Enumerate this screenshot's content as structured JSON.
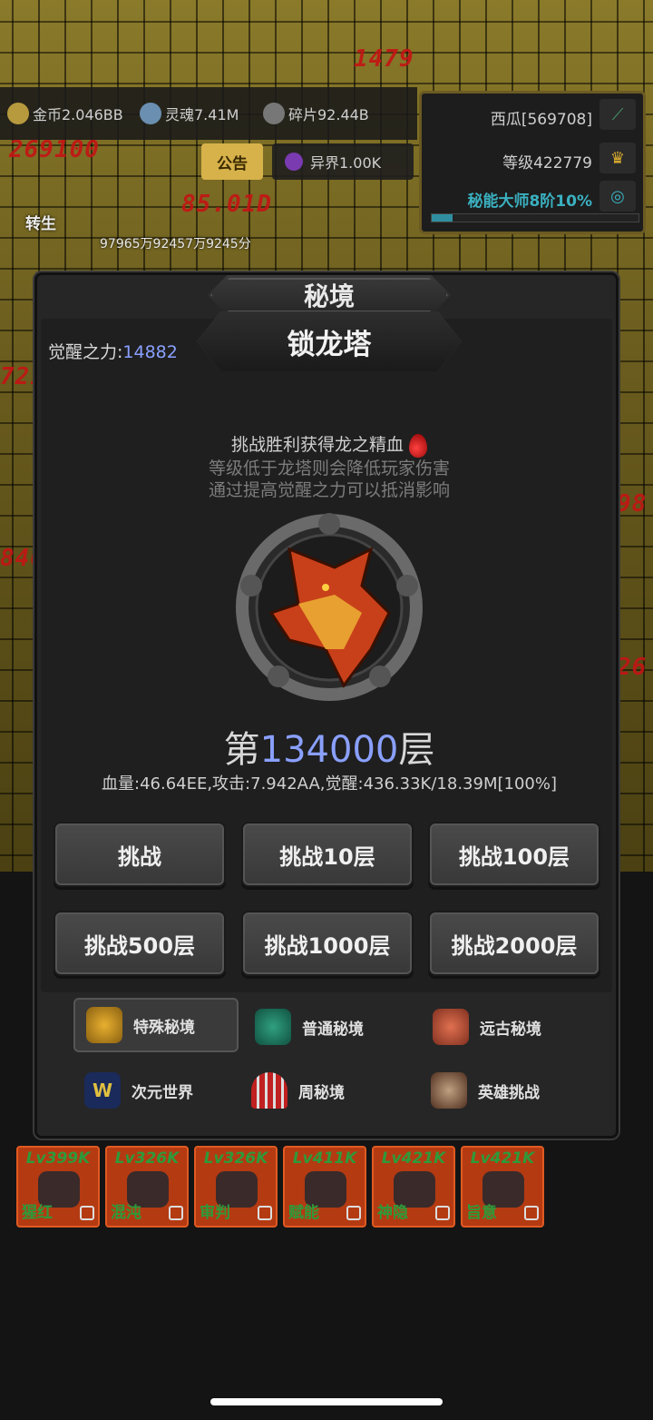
{
  "resources": {
    "gold": "金币2.046BB",
    "soul": "灵魂7.41M",
    "shard": "碎片92.44B",
    "otherworld": "异界1.00K",
    "notice": "公告"
  },
  "player": {
    "name": "西瓜[569708]",
    "level": "等级422779",
    "rank": "秘能大师8阶10%",
    "rank_progress": 0.1,
    "rebirth": "转生",
    "score_line": "97965万92457万9245分"
  },
  "modal": {
    "title": "秘境",
    "tower_name": "锁龙塔",
    "awaken_label": "觉醒之力:",
    "awaken_value": "14882",
    "desc1": "挑战胜利获得龙之精血",
    "desc2": "等级低于龙塔则会降低玩家伤害",
    "desc3": "通过提高觉醒之力可以抵消影响",
    "floor_prefix": "第",
    "floor_number": "134000",
    "floor_suffix": "层",
    "stats": "血量:46.64EE,攻击:7.942AA,觉醒:436.33K/18.39M[100%]",
    "buttons": [
      "挑战",
      "挑战10层",
      "挑战100层",
      "挑战500层",
      "挑战1000层",
      "挑战2000层"
    ],
    "modes": [
      "特殊秘境",
      "普通秘境",
      "远古秘境",
      "次元世界",
      "周秘境",
      "英雄挑战"
    ]
  },
  "slots": [
    {
      "lv": "Lv399K",
      "name": "猩红"
    },
    {
      "lv": "Lv326K",
      "name": "混沌"
    },
    {
      "lv": "Lv326K",
      "name": "审判"
    },
    {
      "lv": "Lv411K",
      "name": "赋能"
    },
    {
      "lv": "Lv421K",
      "name": "神隐"
    },
    {
      "lv": "Lv421K",
      "name": "旨意"
    }
  ],
  "colors": {
    "accent_blue": "#8aa0ff",
    "slot_green": "#2e9a3a",
    "notice_gold": "#d7b14a"
  }
}
